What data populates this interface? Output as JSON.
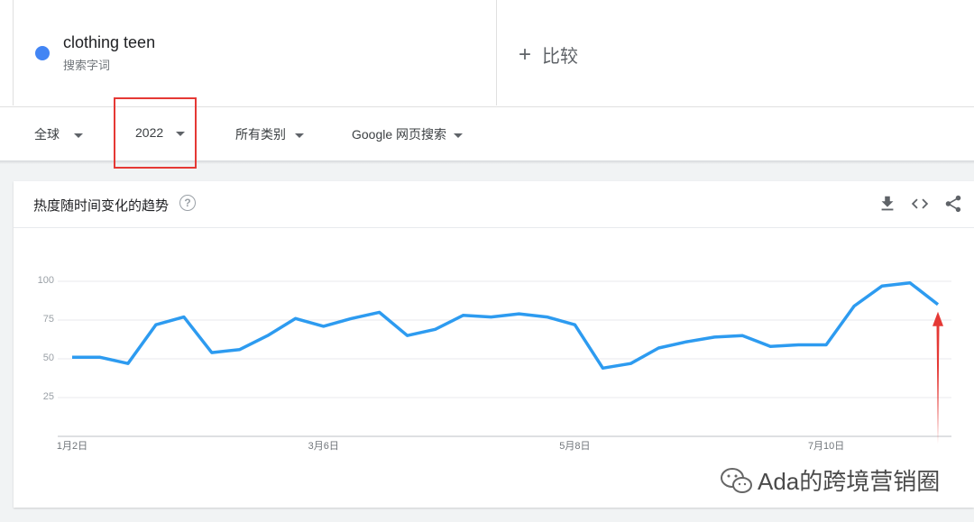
{
  "search_term": {
    "name": "clothing teen",
    "subtitle": "搜索字词",
    "dot_color": "#4285f4"
  },
  "compare": {
    "label": "比较"
  },
  "filters": {
    "region": "全球",
    "period": "2022",
    "category": "所有类别",
    "source": "Google 网页搜索"
  },
  "card": {
    "title": "热度随时间变化的趋势",
    "help_glyph": "?",
    "tools": [
      "download-icon",
      "embed-icon",
      "share-icon"
    ]
  },
  "chart_data": {
    "type": "line",
    "y_ticks": [
      "100",
      "75",
      "50",
      "25"
    ],
    "ylim": [
      0,
      100
    ],
    "x_tick_labels": [
      "1月2日",
      "3月6日",
      "5月8日",
      "7月10日"
    ],
    "x_tick_indices": [
      0,
      9,
      18,
      27
    ],
    "series": [
      {
        "color": "#2d9bf0",
        "values": [
          51,
          51,
          47,
          72,
          77,
          54,
          56,
          65,
          76,
          71,
          76,
          80,
          65,
          69,
          78,
          77,
          79,
          77,
          72,
          44,
          47,
          57,
          61,
          64,
          65,
          58,
          59,
          59,
          84,
          97,
          99,
          85
        ]
      }
    ],
    "grid": true
  },
  "annotation": {
    "arrow_color": "#e53935"
  },
  "watermark": {
    "text": "Ada的跨境营销圈"
  }
}
